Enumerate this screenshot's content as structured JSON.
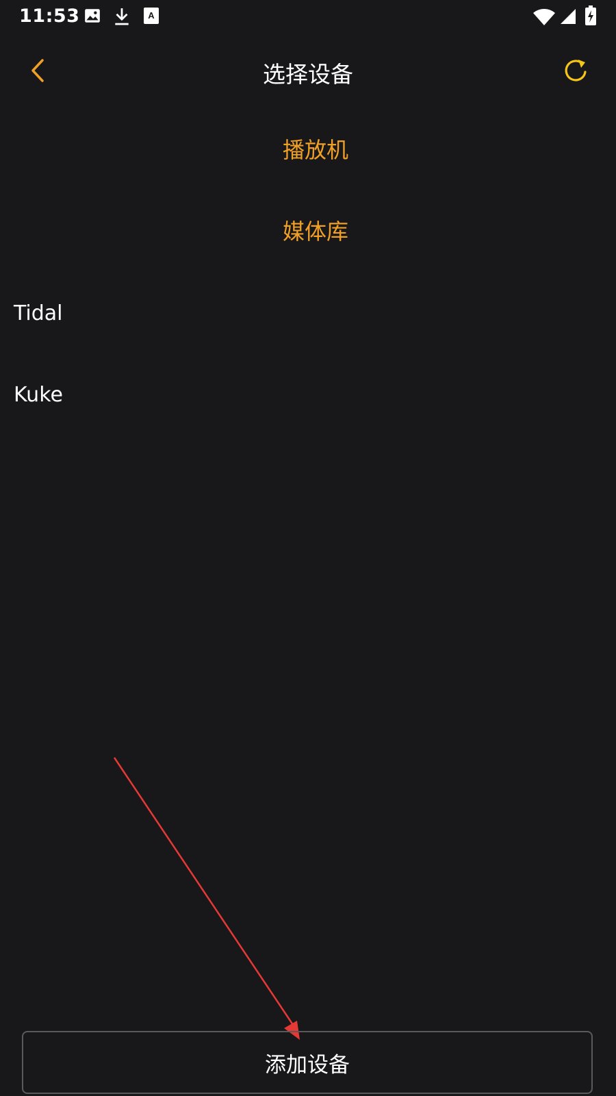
{
  "status_bar": {
    "time": "11:53",
    "left_icons": [
      "image-icon",
      "download-icon",
      "text-a-icon"
    ],
    "right_icons": [
      "wifi-icon",
      "signal-icon",
      "battery-charging-icon"
    ]
  },
  "header": {
    "title": "选择设备",
    "back_icon": "chevron-left-icon",
    "refresh_icon": "refresh-icon"
  },
  "list": {
    "items": [
      {
        "label": "播放机",
        "kind": "section"
      },
      {
        "label": "媒体库",
        "kind": "section"
      },
      {
        "label": "Tidal",
        "kind": "source"
      },
      {
        "label": "Kuke",
        "kind": "source"
      }
    ]
  },
  "footer": {
    "add_button_label": "添加设备"
  },
  "colors": {
    "background": "#18181a",
    "accent": "#f0a027",
    "refresh": "#f5c518",
    "annotation_arrow": "#e53935"
  }
}
